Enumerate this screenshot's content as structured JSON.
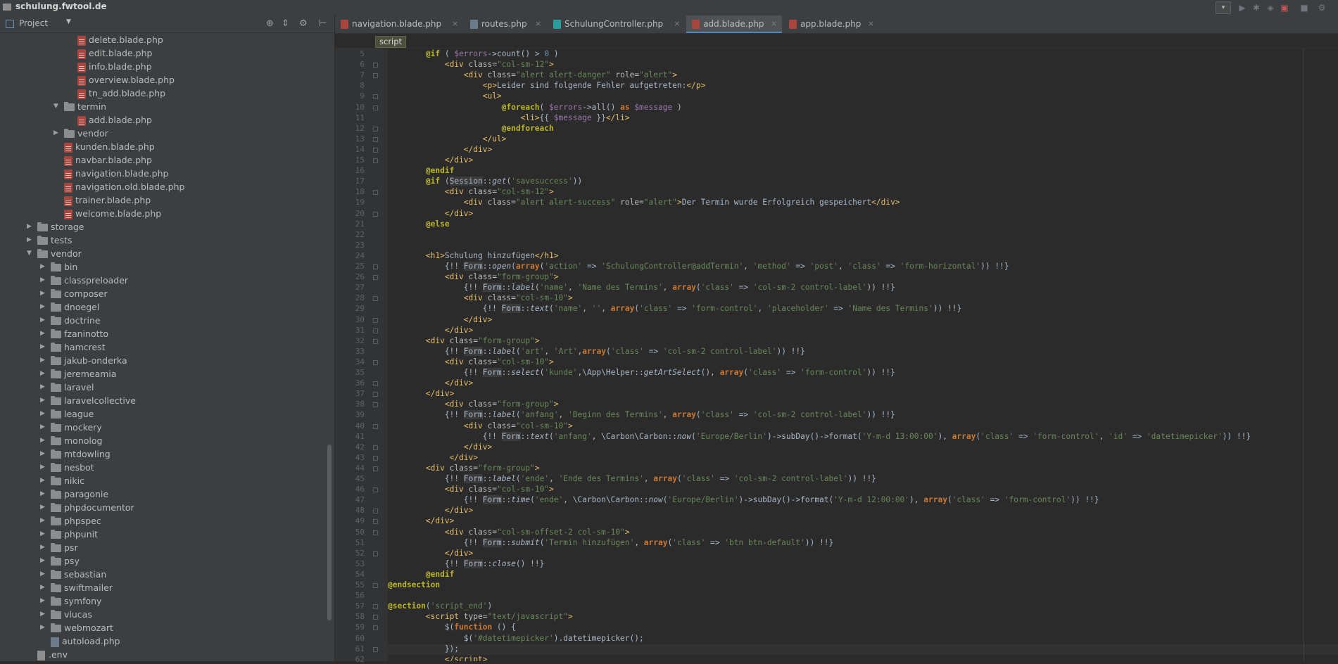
{
  "window": {
    "breadcrumb": "schulung.fwtool.de"
  },
  "toolbar": {
    "run_config": "▾",
    "buttons": [
      "play-icon",
      "debug-icon",
      "coverage-icon",
      "profile-icon",
      "stop-icon",
      "search-icon"
    ]
  },
  "project_panel": {
    "title": "Project",
    "tree": [
      {
        "label": "delete.blade.php",
        "icon": "blade",
        "indent": 4,
        "arrow": ""
      },
      {
        "label": "edit.blade.php",
        "icon": "blade",
        "indent": 4,
        "arrow": ""
      },
      {
        "label": "info.blade.php",
        "icon": "blade",
        "indent": 4,
        "arrow": ""
      },
      {
        "label": "overview.blade.php",
        "icon": "blade",
        "indent": 4,
        "arrow": ""
      },
      {
        "label": "tn_add.blade.php",
        "icon": "blade",
        "indent": 4,
        "arrow": ""
      },
      {
        "label": "termin",
        "icon": "folder",
        "indent": 3,
        "arrow": "▼"
      },
      {
        "label": "add.blade.php",
        "icon": "blade",
        "indent": 4,
        "arrow": ""
      },
      {
        "label": "vendor",
        "icon": "folder",
        "indent": 3,
        "arrow": "▶"
      },
      {
        "label": "kunden.blade.php",
        "icon": "blade",
        "indent": 3,
        "arrow": ""
      },
      {
        "label": "navbar.blade.php",
        "icon": "blade",
        "indent": 3,
        "arrow": ""
      },
      {
        "label": "navigation.blade.php",
        "icon": "blade",
        "indent": 3,
        "arrow": ""
      },
      {
        "label": "navigation.old.blade.php",
        "icon": "blade",
        "indent": 3,
        "arrow": ""
      },
      {
        "label": "trainer.blade.php",
        "icon": "blade",
        "indent": 3,
        "arrow": ""
      },
      {
        "label": "welcome.blade.php",
        "icon": "blade",
        "indent": 3,
        "arrow": ""
      },
      {
        "label": "storage",
        "icon": "folder",
        "indent": 1,
        "arrow": "▶"
      },
      {
        "label": "tests",
        "icon": "folder",
        "indent": 1,
        "arrow": "▶"
      },
      {
        "label": "vendor",
        "icon": "folder",
        "indent": 1,
        "arrow": "▼"
      },
      {
        "label": "bin",
        "icon": "folder",
        "indent": 2,
        "arrow": "▶"
      },
      {
        "label": "classpreloader",
        "icon": "folder",
        "indent": 2,
        "arrow": "▶"
      },
      {
        "label": "composer",
        "icon": "folder",
        "indent": 2,
        "arrow": "▶"
      },
      {
        "label": "dnoegel",
        "icon": "folder",
        "indent": 2,
        "arrow": "▶"
      },
      {
        "label": "doctrine",
        "icon": "folder",
        "indent": 2,
        "arrow": "▶"
      },
      {
        "label": "fzaninotto",
        "icon": "folder",
        "indent": 2,
        "arrow": "▶"
      },
      {
        "label": "hamcrest",
        "icon": "folder",
        "indent": 2,
        "arrow": "▶"
      },
      {
        "label": "jakub-onderka",
        "icon": "folder",
        "indent": 2,
        "arrow": "▶"
      },
      {
        "label": "jeremeamia",
        "icon": "folder",
        "indent": 2,
        "arrow": "▶"
      },
      {
        "label": "laravel",
        "icon": "folder",
        "indent": 2,
        "arrow": "▶"
      },
      {
        "label": "laravelcollective",
        "icon": "folder",
        "indent": 2,
        "arrow": "▶"
      },
      {
        "label": "league",
        "icon": "folder",
        "indent": 2,
        "arrow": "▶"
      },
      {
        "label": "mockery",
        "icon": "folder",
        "indent": 2,
        "arrow": "▶"
      },
      {
        "label": "monolog",
        "icon": "folder",
        "indent": 2,
        "arrow": "▶"
      },
      {
        "label": "mtdowling",
        "icon": "folder",
        "indent": 2,
        "arrow": "▶"
      },
      {
        "label": "nesbot",
        "icon": "folder",
        "indent": 2,
        "arrow": "▶"
      },
      {
        "label": "nikic",
        "icon": "folder",
        "indent": 2,
        "arrow": "▶"
      },
      {
        "label": "paragonie",
        "icon": "folder",
        "indent": 2,
        "arrow": "▶"
      },
      {
        "label": "phpdocumentor",
        "icon": "folder",
        "indent": 2,
        "arrow": "▶"
      },
      {
        "label": "phpspec",
        "icon": "folder",
        "indent": 2,
        "arrow": "▶"
      },
      {
        "label": "phpunit",
        "icon": "folder",
        "indent": 2,
        "arrow": "▶"
      },
      {
        "label": "psr",
        "icon": "folder",
        "indent": 2,
        "arrow": "▶"
      },
      {
        "label": "psy",
        "icon": "folder",
        "indent": 2,
        "arrow": "▶"
      },
      {
        "label": "sebastian",
        "icon": "folder",
        "indent": 2,
        "arrow": "▶"
      },
      {
        "label": "swiftmailer",
        "icon": "folder",
        "indent": 2,
        "arrow": "▶"
      },
      {
        "label": "symfony",
        "icon": "folder",
        "indent": 2,
        "arrow": "▶"
      },
      {
        "label": "vlucas",
        "icon": "folder",
        "indent": 2,
        "arrow": "▶"
      },
      {
        "label": "webmozart",
        "icon": "folder",
        "indent": 2,
        "arrow": "▶"
      },
      {
        "label": "autoload.php",
        "icon": "php",
        "indent": 2,
        "arrow": ""
      },
      {
        "label": ".env",
        "icon": "plain",
        "indent": 1,
        "arrow": ""
      }
    ]
  },
  "tabs": [
    {
      "label": "navigation.blade.php",
      "icon_color": "#a8453c",
      "active": false
    },
    {
      "label": "routes.php",
      "icon_color": "#6c7b8b",
      "active": false
    },
    {
      "label": "SchulungController.php",
      "icon_color": "#2a9d9d",
      "active": false
    },
    {
      "label": "add.blade.php",
      "icon_color": "#a8453c",
      "active": true
    },
    {
      "label": "app.blade.php",
      "icon_color": "#a8453c",
      "active": false
    }
  ],
  "breadcrumb_tag": "script",
  "editor": {
    "lines": [
      {
        "n": 5,
        "html": "        <span class='d'>@if</span> ( <span class='v'>$errors</span>-&gt;count() &gt; <span class='n'>0</span> )"
      },
      {
        "n": 6,
        "html": "            <span class='t'>&lt;div</span> <span class='a'>class=</span><span class='s'>\"col-sm-12\"</span><span class='t'>&gt;</span>"
      },
      {
        "n": 7,
        "html": "                <span class='t'>&lt;div</span> <span class='a'>class=</span><span class='s'>\"alert alert-danger\"</span> <span class='a'>role=</span><span class='s'>\"alert\"</span><span class='t'>&gt;</span>"
      },
      {
        "n": 8,
        "html": "                    <span class='t'>&lt;p&gt;</span>Leider sind folgende Fehler aufgetreten:<span class='t'>&lt;/p&gt;</span>"
      },
      {
        "n": 9,
        "html": "                    <span class='t'>&lt;ul&gt;</span>"
      },
      {
        "n": 10,
        "html": "                        <span class='d'>@foreach</span>( <span class='v'>$errors</span>-&gt;all() <span class='k'>as</span> <span class='v'>$message</span> )"
      },
      {
        "n": 11,
        "html": "                            <span class='t'>&lt;li&gt;</span>{{ <span class='v'>$message</span> }}<span class='t'>&lt;/li&gt;</span>"
      },
      {
        "n": 12,
        "html": "                        <span class='d'>@endforeach</span>"
      },
      {
        "n": 13,
        "html": "                    <span class='t'>&lt;/ul&gt;</span>"
      },
      {
        "n": 14,
        "html": "                <span class='t'>&lt;/div&gt;</span>"
      },
      {
        "n": 15,
        "html": "            <span class='t'>&lt;/div&gt;</span>"
      },
      {
        "n": 16,
        "html": "        <span class='d'>@endif</span>"
      },
      {
        "n": 17,
        "html": "        <span class='d'>@if</span> (<span class='h'>Session</span>::<span class='i'>get</span>(<span class='s'>'savesuccess'</span>))"
      },
      {
        "n": 18,
        "html": "            <span class='t'>&lt;div</span> <span class='a'>class=</span><span class='s'>\"col-sm-12\"</span><span class='t'>&gt;</span>"
      },
      {
        "n": 19,
        "html": "                <span class='t'>&lt;div</span> <span class='a'>class=</span><span class='s'>\"alert alert-success\"</span> <span class='a'>role=</span><span class='s'>\"alert\"</span><span class='t'>&gt;</span>Der Termin wurde Erfolgreich gespeichert<span class='t'>&lt;/div&gt;</span>"
      },
      {
        "n": 20,
        "html": "            <span class='t'>&lt;/div&gt;</span>"
      },
      {
        "n": 21,
        "html": "        <span class='d'>@else</span>"
      },
      {
        "n": 22,
        "html": ""
      },
      {
        "n": 23,
        "html": ""
      },
      {
        "n": 24,
        "html": "        <span class='t'>&lt;h1&gt;</span>Schulung hinzufügen<span class='t'>&lt;/h1&gt;</span>"
      },
      {
        "n": 25,
        "html": "            {!! <span class='h'>Form</span>::<span class='i'>open</span>(<span class='k'>array</span>(<span class='s'>'action'</span> =&gt; <span class='s'>'SchulungController@addTermin'</span>, <span class='s'>'method'</span> =&gt; <span class='s'>'post'</span>, <span class='s'>'class'</span> =&gt; <span class='s'>'form-horizontal'</span>)) !!}"
      },
      {
        "n": 26,
        "html": "            <span class='t'>&lt;div</span> <span class='a'>class=</span><span class='s'>\"form-group\"</span><span class='t'>&gt;</span>"
      },
      {
        "n": 27,
        "html": "                {!! <span class='h'>Form</span>::<span class='i'>label</span>(<span class='s'>'name'</span>, <span class='s'>'Name des Termins'</span>, <span class='k'>array</span>(<span class='s'>'class'</span> =&gt; <span class='s'>'col-sm-2 control-label'</span>)) !!}"
      },
      {
        "n": 28,
        "html": "                <span class='t'>&lt;div</span> <span class='a'>class=</span><span class='s'>\"col-sm-10\"</span><span class='t'>&gt;</span>"
      },
      {
        "n": 29,
        "html": "                    {!! <span class='h'>Form</span>::<span class='i'>text</span>(<span class='s'>'name'</span>, <span class='s'>''</span>, <span class='k'>array</span>(<span class='s'>'class'</span> =&gt; <span class='s'>'form-control'</span>, <span class='s'>'placeholder'</span> =&gt; <span class='s'>'Name des Termins'</span>)) !!}"
      },
      {
        "n": 30,
        "html": "                <span class='t'>&lt;/div&gt;</span>"
      },
      {
        "n": 31,
        "html": "            <span class='t'>&lt;/div&gt;</span>"
      },
      {
        "n": 32,
        "html": "        <span class='t'>&lt;div</span> <span class='a'>class=</span><span class='s'>\"form-group\"</span><span class='t'>&gt;</span>"
      },
      {
        "n": 33,
        "html": "            {!! <span class='h'>Form</span>::<span class='i'>label</span>(<span class='s'>'art'</span>, <span class='s'>'Art'</span>,<span class='k'>array</span>(<span class='s'>'class'</span> =&gt; <span class='s'>'col-sm-2 control-label'</span>)) !!}"
      },
      {
        "n": 34,
        "html": "            <span class='t'>&lt;div</span> <span class='a'>class=</span><span class='s'>\"col-sm-10\"</span><span class='t'>&gt;</span>"
      },
      {
        "n": 35,
        "html": "                {!! <span class='h'>Form</span>::<span class='i'>select</span>(<span class='s'>'kunde'</span>,\\App\\Helper::<span class='i'>getArtSelect</span>(), <span class='k'>array</span>(<span class='s'>'class'</span> =&gt; <span class='s'>'form-control'</span>)) !!}"
      },
      {
        "n": 36,
        "html": "            <span class='t'>&lt;/div&gt;</span>"
      },
      {
        "n": 37,
        "html": "        <span class='t'>&lt;/div&gt;</span>"
      },
      {
        "n": 38,
        "html": "            <span class='t'>&lt;div</span> <span class='a'>class=</span><span class='s'>\"form-group\"</span><span class='t'>&gt;</span>"
      },
      {
        "n": 39,
        "html": "            {!! <span class='h'>Form</span>::<span class='i'>label</span>(<span class='s'>'anfang'</span>, <span class='s'>'Beginn des Termins'</span>, <span class='k'>array</span>(<span class='s'>'class'</span> =&gt; <span class='s'>'col-sm-2 control-label'</span>)) !!}"
      },
      {
        "n": 40,
        "html": "                <span class='t'>&lt;div</span> <span class='a'>class=</span><span class='s'>\"col-sm-10\"</span><span class='t'>&gt;</span>"
      },
      {
        "n": 41,
        "html": "                    {!! <span class='h'>Form</span>::<span class='i'>text</span>(<span class='s'>'anfang'</span>, \\Carbon\\Carbon::<span class='i'>now</span>(<span class='s'>'Europe/Berlin'</span>)-&gt;subDay()-&gt;format(<span class='s'>'Y-m-d 13:00:00'</span>), <span class='k'>array</span>(<span class='s'>'class'</span> =&gt; <span class='s'>'form-control'</span>, <span class='s'>'id'</span> =&gt; <span class='s'>'datetimepicker'</span>)) !!}"
      },
      {
        "n": 42,
        "html": "                <span class='t'>&lt;/div&gt;</span>"
      },
      {
        "n": 43,
        "html": "             <span class='t'>&lt;/div&gt;</span>"
      },
      {
        "n": 44,
        "html": "        <span class='t'>&lt;div</span> <span class='a'>class=</span><span class='s'>\"form-group\"</span><span class='t'>&gt;</span>"
      },
      {
        "n": 45,
        "html": "            {!! <span class='h'>Form</span>::<span class='i'>label</span>(<span class='s'>'ende'</span>, <span class='s'>'Ende des Termins'</span>, <span class='k'>array</span>(<span class='s'>'class'</span> =&gt; <span class='s'>'col-sm-2 control-label'</span>)) !!}"
      },
      {
        "n": 46,
        "html": "            <span class='t'>&lt;div</span> <span class='a'>class=</span><span class='s'>\"col-sm-10\"</span><span class='t'>&gt;</span>"
      },
      {
        "n": 47,
        "html": "                {!! <span class='h'>Form</span>::<span class='i'>time</span>(<span class='s'>'ende'</span>, \\Carbon\\Carbon::<span class='i'>now</span>(<span class='s'>'Europe/Berlin'</span>)-&gt;subDay()-&gt;format(<span class='s'>'Y-m-d 12:00:00'</span>), <span class='k'>array</span>(<span class='s'>'class'</span> =&gt; <span class='s'>'form-control'</span>)) !!}"
      },
      {
        "n": 48,
        "html": "            <span class='t'>&lt;/div&gt;</span>"
      },
      {
        "n": 49,
        "html": "        <span class='t'>&lt;/div&gt;</span>"
      },
      {
        "n": 50,
        "html": "            <span class='t'>&lt;div</span> <span class='a'>class=</span><span class='s'>\"col-sm-offset-2 col-sm-10\"</span><span class='t'>&gt;</span>"
      },
      {
        "n": 51,
        "html": "                {!! <span class='h'>Form</span>::<span class='i'>submit</span>(<span class='s'>'Termin hinzufügen'</span>, <span class='k'>array</span>(<span class='s'>'class'</span> =&gt; <span class='s'>'btn btn-default'</span>)) !!}"
      },
      {
        "n": 52,
        "html": "            <span class='t'>&lt;/div&gt;</span>"
      },
      {
        "n": 53,
        "html": "            {!! <span class='h'>Form</span>::<span class='i'>close</span>() !!}"
      },
      {
        "n": 54,
        "html": "        <span class='d'>@endif</span>"
      },
      {
        "n": 55,
        "html": "<span class='d'>@endsection</span>"
      },
      {
        "n": 56,
        "html": ""
      },
      {
        "n": 57,
        "html": "<span class='d'>@section</span>(<span class='s'>'script_end'</span>)"
      },
      {
        "n": 58,
        "html": "        <span class='t'>&lt;script</span> <span class='a'>type=</span><span class='s'>\"text/javascript\"</span><span class='t'>&gt;</span>"
      },
      {
        "n": 59,
        "html": "            $(<span class='k'>function</span> () {"
      },
      {
        "n": 60,
        "html": "                $(<span class='s'>'#datetimepicker'</span>).datetimepicker();"
      },
      {
        "n": 61,
        "html": "            });"
      },
      {
        "n": 62,
        "html": "            <span class='t'>&lt;/script&gt;</span>"
      }
    ]
  }
}
